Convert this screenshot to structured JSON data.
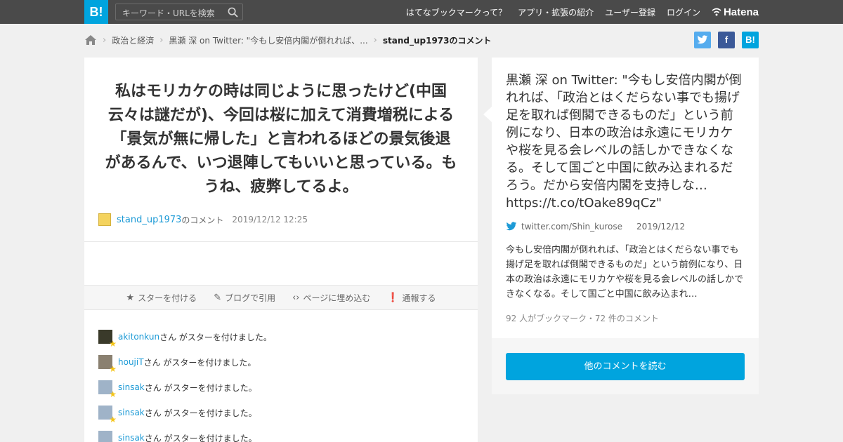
{
  "header": {
    "logo": "B!",
    "search_placeholder": "キーワード・URLを検索",
    "nav": [
      "はてなブックマークって？",
      "アプリ・拡張の紹介",
      "ユーザー登録",
      "ログイン"
    ],
    "hatena_label": "Hatena"
  },
  "breadcrumb": {
    "items": [
      "政治と経済",
      "黒瀬 深 on Twitter: \"今もし安倍内閣が倒れれば、...",
      "stand_up1973のコメント"
    ]
  },
  "share": {
    "twitter": "t",
    "facebook": "f",
    "hatebu": "B!"
  },
  "comment": {
    "text": "私はモリカケの時は同じように思ったけど(中国云々は謎だが)、今回は桜に加えて消費増税による「景気が無に帰した」と言われるほどの景気後退があるんで、いつ退陣してもいいと思っている。もうね、疲弊してるよ。",
    "user": "stand_up1973",
    "user_suffix": "のコメント",
    "date": "2019/12/12 12:25"
  },
  "actions": [
    "スターを付ける",
    "ブログで引用",
    "ページに埋め込む",
    "通報する"
  ],
  "stars": {
    "suffix": "さん がスターを付けました。",
    "users": [
      "akitonkun",
      "houjiT",
      "sinsak",
      "sinsak",
      "sinsak"
    ]
  },
  "entry": {
    "title": "黒瀬 深 on Twitter: \"今もし安倍内閣が倒れれば、「政治とはくだらない事でも揚げ足を取れば倒閣できるものだ」という前例になり、日本の政治は永遠にモリカケや桜を見る会レベルの話しかできなくなる。そして国ごと中国に飲み込まれるだろう。だから安倍内閣を支持しな… https://t.co/tOake89qCz\"",
    "source": "twitter.com/Shin_kurose",
    "date": "2019/12/12",
    "summary": "今もし安倍内閣が倒れれば、「政治とはくだらない事でも揚げ足を取れば倒閣できるものだ」という前例になり、日本の政治は永遠にモリカケや桜を見る会レベルの話しかできなくなる。そして国ごと中国に飲み込まれ…",
    "counts": "92 人がブックマーク・72 件のコメント",
    "more_button": "他のコメントを読む"
  },
  "colors": {
    "topbar": "#4a4a4a",
    "brand": "#00a4de",
    "link": "#1c9ad6",
    "star": "#f5c518",
    "twitter": "#55acee",
    "facebook": "#3b5998"
  }
}
